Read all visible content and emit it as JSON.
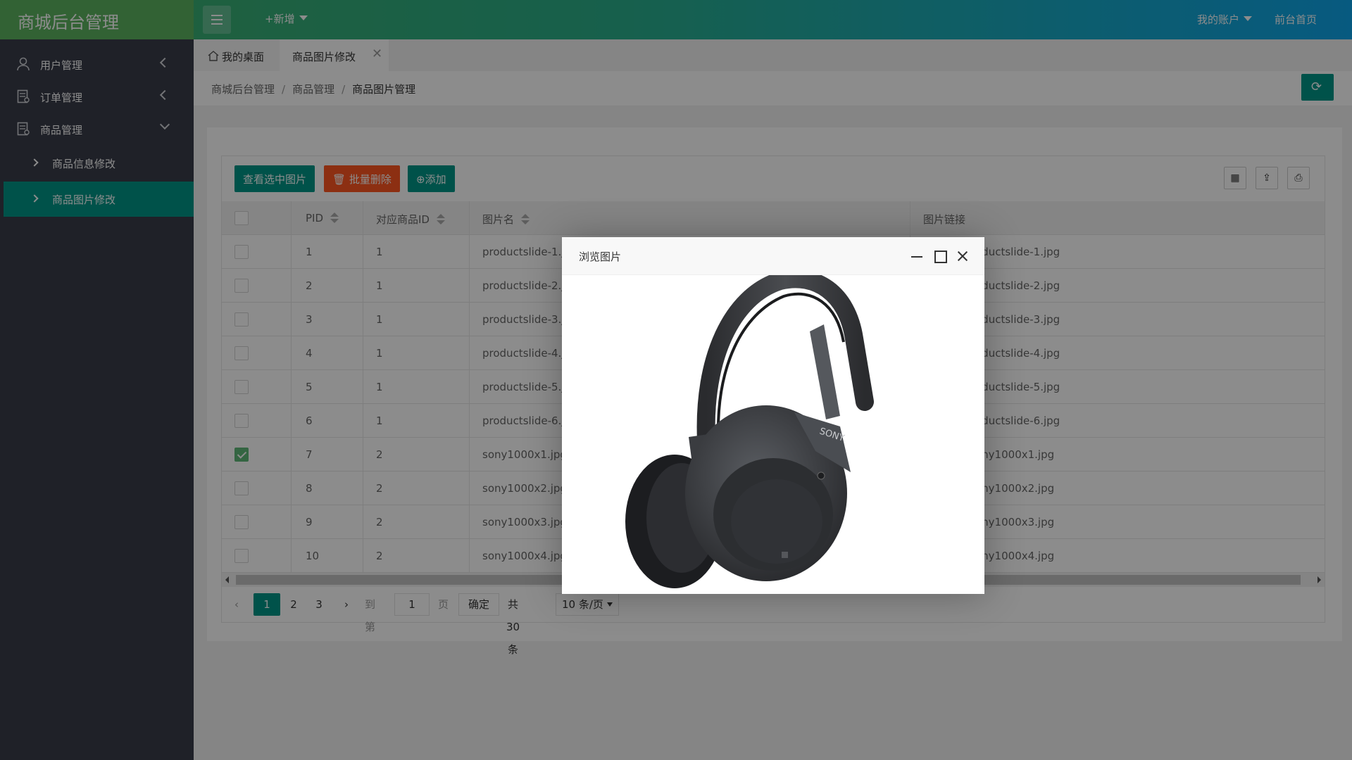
{
  "app": {
    "title": "商城后台管理"
  },
  "header": {
    "add_new": "+新增",
    "account": "我的账户",
    "home": "前台首页"
  },
  "sidebar": {
    "items": [
      {
        "label": "用户管理"
      },
      {
        "label": "订单管理"
      },
      {
        "label": "商品管理"
      }
    ],
    "sub_items": [
      {
        "label": "商品信息修改"
      },
      {
        "label": "商品图片修改"
      }
    ]
  },
  "tabs": [
    {
      "label": "我的桌面"
    },
    {
      "label": "商品图片修改",
      "close": "✕"
    }
  ],
  "breadcrumb": [
    "商城后台管理",
    "商品管理",
    "商品图片管理"
  ],
  "toolbar": {
    "view": "查看选中图片",
    "delete": "批量删除",
    "add": "添加"
  },
  "table": {
    "columns": [
      "PID",
      "对应商品ID",
      "图片名",
      "图片链接"
    ],
    "rows": [
      {
        "pid": "1",
        "goods": "1",
        "name": "productslide-1.jpg",
        "link": "oductslide-1.jpg",
        "checked": false
      },
      {
        "pid": "2",
        "goods": "1",
        "name": "productslide-2.jpg",
        "link": "oductslide-2.jpg",
        "checked": false
      },
      {
        "pid": "3",
        "goods": "1",
        "name": "productslide-3.jpg",
        "link": "oductslide-3.jpg",
        "checked": false
      },
      {
        "pid": "4",
        "goods": "1",
        "name": "productslide-4.jpg",
        "link": "oductslide-4.jpg",
        "checked": false
      },
      {
        "pid": "5",
        "goods": "1",
        "name": "productslide-5.jpg",
        "link": "oductslide-5.jpg",
        "checked": false
      },
      {
        "pid": "6",
        "goods": "1",
        "name": "productslide-6.jpg",
        "link": "oductslide-6.jpg",
        "checked": false
      },
      {
        "pid": "7",
        "goods": "2",
        "name": "sony1000x1.jpg",
        "link": "ony1000x1.jpg",
        "checked": true
      },
      {
        "pid": "8",
        "goods": "2",
        "name": "sony1000x2.jpg",
        "link": "ony1000x2.jpg",
        "checked": false
      },
      {
        "pid": "9",
        "goods": "2",
        "name": "sony1000x3.jpg",
        "link": "ony1000x3.jpg",
        "checked": false
      },
      {
        "pid": "10",
        "goods": "2",
        "name": "sony1000x4.jpg",
        "link": "ony1000x4.jpg",
        "checked": false
      }
    ]
  },
  "pager": {
    "pages": [
      "1",
      "2",
      "3"
    ],
    "current": "1",
    "goto_label": "到第",
    "goto_value": "1",
    "page_unit": "页",
    "confirm": "确定",
    "total": "共 30 条",
    "per_page": "10 条/页"
  },
  "modal": {
    "title": "浏览图片",
    "brand": "SONY"
  },
  "colors": {
    "primary": "#009688",
    "danger": "#ff5722",
    "sidebar": "#393d49"
  }
}
